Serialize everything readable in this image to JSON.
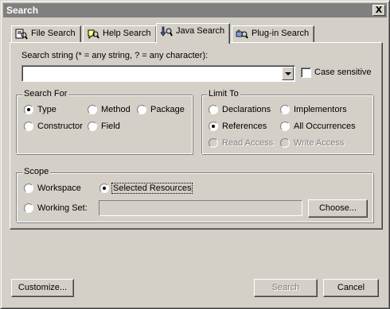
{
  "window": {
    "title": "Search",
    "close_symbol": "X"
  },
  "tabs": [
    {
      "label": "File Search",
      "icon": "file-search-icon",
      "active": false
    },
    {
      "label": "Help Search",
      "icon": "help-search-icon",
      "active": false
    },
    {
      "label": "Java Search",
      "icon": "java-search-icon",
      "active": true
    },
    {
      "label": "Plug-in Search",
      "icon": "plugin-search-icon",
      "active": false
    }
  ],
  "search_string": {
    "label": "Search string (* = any string, ? = any character):",
    "value": "",
    "case_sensitive_label": "Case sensitive",
    "case_sensitive_checked": false
  },
  "search_for": {
    "title": "Search For",
    "options": [
      "Type",
      "Method",
      "Package",
      "Constructor",
      "Field"
    ],
    "selected": "Type"
  },
  "limit_to": {
    "title": "Limit To",
    "options": [
      "Declarations",
      "Implementors",
      "References",
      "All Occurrences",
      "Read Access",
      "Write Access"
    ],
    "selected": "References",
    "disabled": [
      "Read Access",
      "Write Access"
    ]
  },
  "scope": {
    "title": "Scope",
    "workspace_label": "Workspace",
    "selected_resources_label": "Selected Resources",
    "working_set_label": "Working Set:",
    "working_set_value": "",
    "choose_label": "Choose...",
    "selected": "Selected Resources"
  },
  "buttons": {
    "customize": "Customize...",
    "search": "Search",
    "cancel": "Cancel"
  },
  "colors": {
    "face": "#d4d0c8",
    "titlebar": "#808080",
    "disabled_text": "#808080"
  }
}
